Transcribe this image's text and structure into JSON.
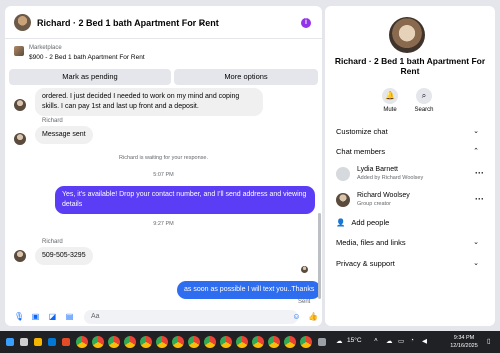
{
  "header": {
    "title": "Richard · 2 Bed 1 bath Apartment For Rent",
    "info_icon": "info-icon"
  },
  "marketplace": {
    "label": "Marketplace",
    "listing": "$900 - 2 Bed 1 bath Apartment For Rent",
    "mark_pending": "Mark as pending",
    "more_options": "More options"
  },
  "messages": {
    "m1_text": "ordered. I just decided I needed to work on my mind and coping skills. I can pay 1st and last  up front and a deposit.",
    "m2_sender": "Richard",
    "m2_text": "Message sent",
    "waiting_note": "Richard is waiting for your response.",
    "time1": "5:07 PM",
    "m3_text": "Yes, it's available! Drop your contact number, and I'll send address and viewing details",
    "time2": "9:27 PM",
    "m4_sender": "Richard",
    "m4_text": "509-505-3295",
    "m5_text": "as soon as possible I will text you..Thanks",
    "m5_status": "Sent"
  },
  "composer": {
    "placeholder": "Aa"
  },
  "details": {
    "name": "Richard · 2 Bed 1 bath Apartment For Rent",
    "mute": "Mute",
    "search": "Search",
    "customize_chat": "Customize chat",
    "chat_members": "Chat members",
    "members": [
      {
        "name": "Lydia Barnett",
        "sub": "Added by Richard Woolsey"
      },
      {
        "name": "Richard Woolsey",
        "sub": "Group creator"
      }
    ],
    "add_people": "Add people",
    "media_files_links": "Media, files and links",
    "privacy_support": "Privacy & support"
  },
  "taskbar": {
    "weather": "15°C",
    "time": "9:34 PM",
    "date": "12/16/2025"
  },
  "colors": {
    "accent": "#9333ea",
    "outgoing_bubble": "#5b3df5",
    "outgoing_bubble_last": "#2f6df0",
    "messenger_blue": "#0866ff"
  }
}
